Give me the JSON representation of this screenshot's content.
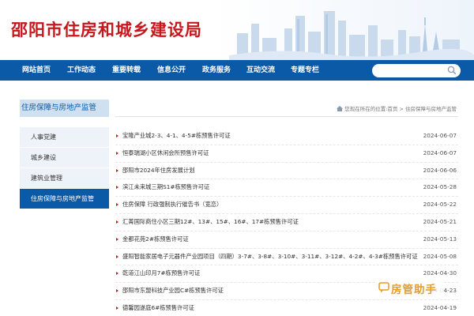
{
  "site": {
    "title": "邵阳市住房和城乡建设局"
  },
  "nav": {
    "items": [
      "网站首页",
      "工作动态",
      "重要转载",
      "信息公开",
      "政务服务",
      "互动交流",
      "专题专栏"
    ],
    "search_placeholder": ""
  },
  "sidebar": {
    "title": "住房保障与房地产监管",
    "items": [
      {
        "label": "人事党建",
        "active": false
      },
      {
        "label": "城乡建设",
        "active": false
      },
      {
        "label": "建筑业管理",
        "active": false
      },
      {
        "label": "住房保障与房地产监管",
        "active": true
      }
    ]
  },
  "breadcrumb": {
    "prefix": "您现在所在的位置:",
    "home": "首页",
    "separator": " > ",
    "current": "住房保障与房地产监管"
  },
  "articles": [
    {
      "title": "宝隆产业城2-3、4-1、4-5#栋预售许可证",
      "date": "2024-06-07"
    },
    {
      "title": "恒泰瑞湖小区休闲会所预售许可证",
      "date": "2024-06-07"
    },
    {
      "title": "邵阳市2024年住房发展计划",
      "date": "2024-06-06"
    },
    {
      "title": "滨江未来城三期S1#栋预售许可证",
      "date": "2024-05-28"
    },
    {
      "title": "住房保障 行政强制执行催告书（宽恋）",
      "date": "2024-05-22"
    },
    {
      "title": "汇菁国际商住小区三期12#、13#、15#、16#、17#栋预售许可证",
      "date": "2024-05-21"
    },
    {
      "title": "金都花苑2#栋预售许可证",
      "date": "2024-05-13"
    },
    {
      "title": "盛阳智能家居电子元器件产业园项目（四期）3-7#、3-8#、3-10#、3-11#、3-12#、4-2#、4-3#栋预售许可证",
      "date": "2024-05-08"
    },
    {
      "title": "乾道江山印月7#栋预售许可证",
      "date": "2024-04-30"
    },
    {
      "title": "邵阳市东盟科技产业园C#栋预售许可证",
      "date": "2024-04-23"
    },
    {
      "title": "德馨园遂庭6#栋预售许可证",
      "date": "2024-04-19"
    }
  ],
  "watermark": {
    "text": "房管助手"
  },
  "colors": {
    "brand_red": "#c8161d",
    "nav_blue": "#0b5aa8",
    "side_light": "#eef3f9",
    "watermark": "#e69c28"
  },
  "icons": {
    "search": "search-icon",
    "home": "home-icon",
    "bullet": "bullet-arrow-icon",
    "watermark": "chat-bubble-icon"
  }
}
